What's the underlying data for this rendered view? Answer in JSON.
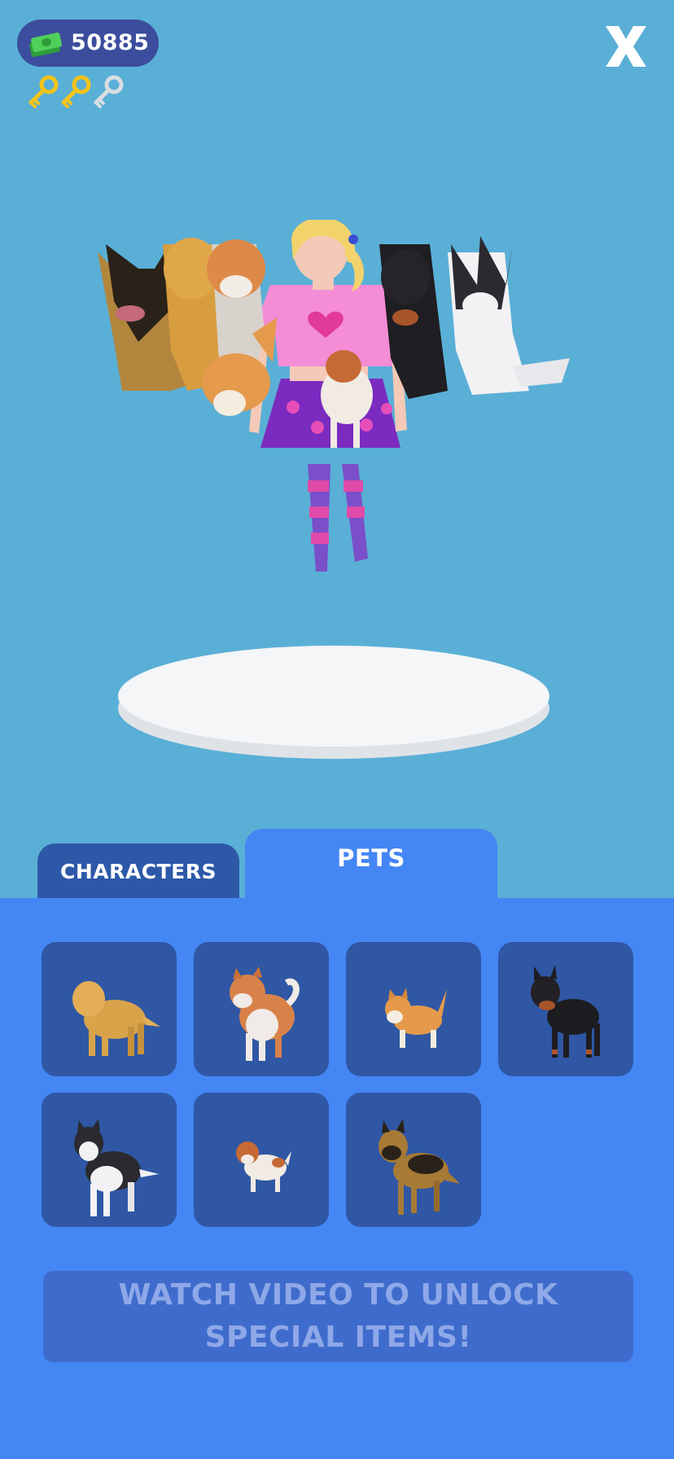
{
  "currency": {
    "amount": "50885",
    "icon": "cash-stack-icon"
  },
  "keys": {
    "collected": 2,
    "total": 3,
    "icon": "key-icon"
  },
  "close": {
    "label": "X",
    "icon": "close-icon"
  },
  "tabs": [
    {
      "label": "CHARACTERS",
      "active": false
    },
    {
      "label": "PETS",
      "active": true
    }
  ],
  "pets": [
    {
      "name": "golden-retriever",
      "icon": "golden-retriever-icon"
    },
    {
      "name": "shiba-inu",
      "icon": "shiba-inu-icon"
    },
    {
      "name": "corgi",
      "icon": "corgi-icon"
    },
    {
      "name": "doberman",
      "icon": "doberman-icon"
    },
    {
      "name": "husky",
      "icon": "husky-icon"
    },
    {
      "name": "jack-russell",
      "icon": "jack-russell-icon"
    },
    {
      "name": "german-shepherd",
      "icon": "german-shepherd-icon"
    }
  ],
  "watch_button": {
    "line1": "WATCH VIDEO TO UNLOCK",
    "line2": "SPECIAL ITEMS!"
  },
  "colors": {
    "background": "#5aafd6",
    "panel": "#4486f4",
    "card": "#2f57a4",
    "tab_inactive": "#2d58a8",
    "pill": "#3b4d9c"
  }
}
